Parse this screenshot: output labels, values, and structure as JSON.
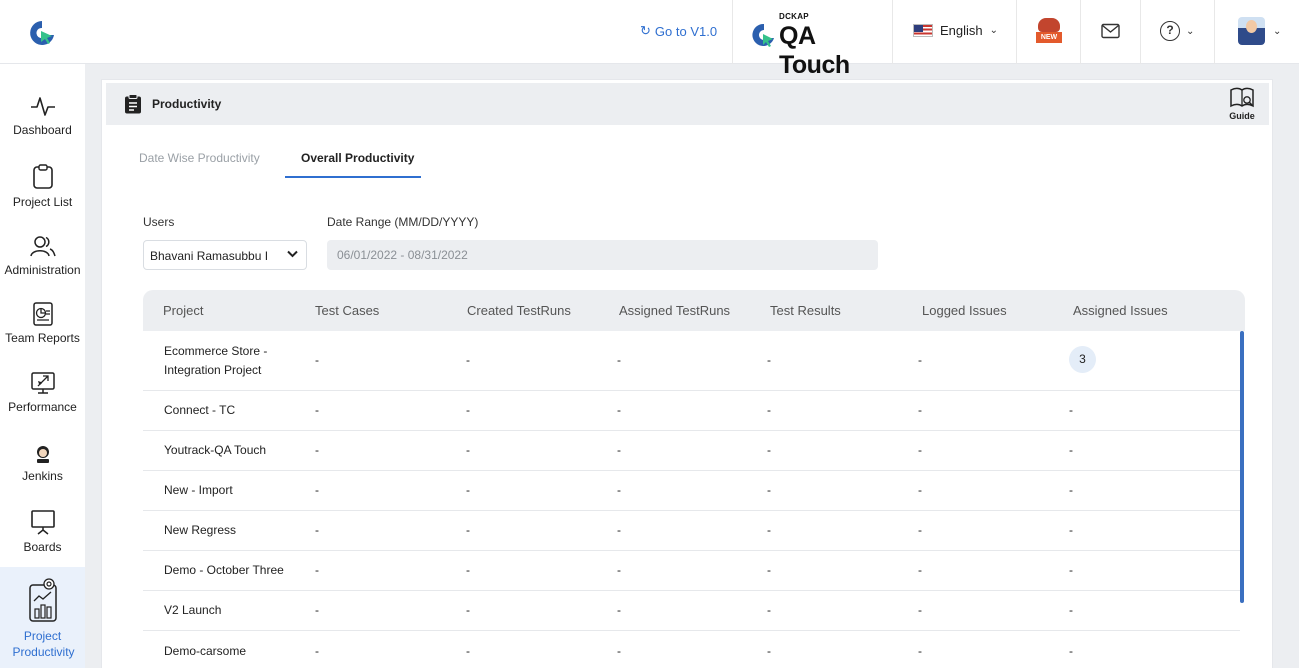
{
  "header": {
    "goto_label": "Go to V1.0",
    "brand_small": "DCKAP",
    "brand_name": "QA Touch",
    "language": "English",
    "new_badge": "NEW"
  },
  "sidebar": {
    "items": [
      {
        "label": "Dashboard",
        "icon": "activity-icon"
      },
      {
        "label": "Project List",
        "icon": "clipboard-icon"
      },
      {
        "label": "Administration",
        "icon": "users-icon"
      },
      {
        "label": "Team Reports",
        "icon": "report-icon"
      },
      {
        "label": "Performance",
        "icon": "performance-icon"
      },
      {
        "label": "Jenkins",
        "icon": "jenkins-icon"
      },
      {
        "label": "Boards",
        "icon": "board-icon"
      },
      {
        "label": "Project Productivity",
        "icon": "productivity-icon"
      }
    ]
  },
  "page": {
    "title": "Productivity",
    "guide_label": "Guide",
    "tabs": [
      "Date Wise Productivity",
      "Overall Productivity"
    ],
    "active_tab": "Overall Productivity"
  },
  "filters": {
    "users_label": "Users",
    "users_value": "Bhavani Ramasubbu I",
    "date_label": "Date Range (MM/DD/YYYY)",
    "date_value": "06/01/2022 - 08/31/2022"
  },
  "table": {
    "columns": [
      "Project",
      "Test Cases",
      "Created TestRuns",
      "Assigned TestRuns",
      "Test Results",
      "Logged Issues",
      "Assigned Issues"
    ],
    "rows": [
      {
        "project": "Ecommerce Store - Integration Project",
        "test_cases": "-",
        "created_testruns": "-",
        "assigned_testruns": "-",
        "test_results": "-",
        "logged_issues": "-",
        "assigned_issues": "3"
      },
      {
        "project": "Connect - TC",
        "test_cases": "-",
        "created_testruns": "-",
        "assigned_testruns": "-",
        "test_results": "-",
        "logged_issues": "-",
        "assigned_issues": "-"
      },
      {
        "project": "Youtrack-QA Touch",
        "test_cases": "-",
        "created_testruns": "-",
        "assigned_testruns": "-",
        "test_results": "-",
        "logged_issues": "-",
        "assigned_issues": "-"
      },
      {
        "project": "New - Import",
        "test_cases": "-",
        "created_testruns": "-",
        "assigned_testruns": "-",
        "test_results": "-",
        "logged_issues": "-",
        "assigned_issues": "-"
      },
      {
        "project": "New Regress",
        "test_cases": "-",
        "created_testruns": "-",
        "assigned_testruns": "-",
        "test_results": "-",
        "logged_issues": "-",
        "assigned_issues": "-"
      },
      {
        "project": "Demo - October Three",
        "test_cases": "-",
        "created_testruns": "-",
        "assigned_testruns": "-",
        "test_results": "-",
        "logged_issues": "-",
        "assigned_issues": "-"
      },
      {
        "project": "V2 Launch",
        "test_cases": "-",
        "created_testruns": "-",
        "assigned_testruns": "-",
        "test_results": "-",
        "logged_issues": "-",
        "assigned_issues": "-"
      },
      {
        "project": "Demo-carsome",
        "test_cases": "-",
        "created_testruns": "-",
        "assigned_testruns": "-",
        "test_results": "-",
        "logged_issues": "-",
        "assigned_issues": "-"
      }
    ]
  },
  "colors": {
    "accent": "#2f6fd0",
    "brand_green": "#35c28b",
    "brand_blue": "#2b5fae"
  }
}
